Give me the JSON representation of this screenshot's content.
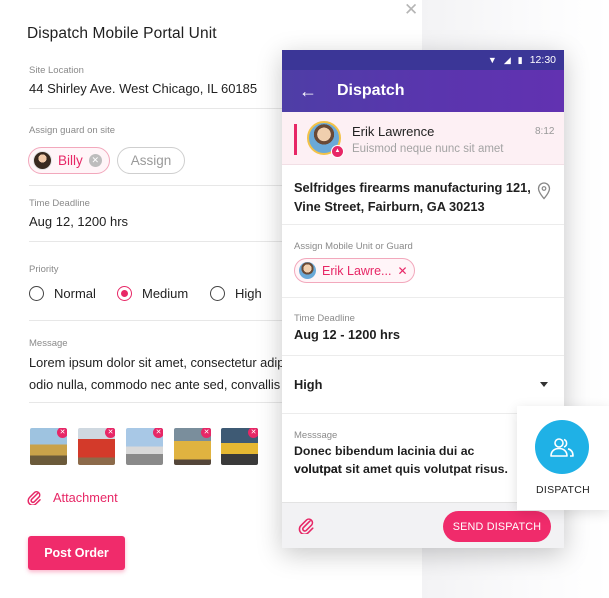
{
  "desktop": {
    "title": "Dispatch Mobile Portal Unit",
    "close_icon": "close-icon",
    "site_location_label": "Site Location",
    "site_location_value": "44 Shirley Ave. West Chicago, IL 60185",
    "assign_label": "Assign guard on site",
    "assigned_guard": "Billy",
    "assign_button": "Assign",
    "deadline_label": "Time Deadline",
    "deadline_value": "Aug 12, 1200 hrs",
    "priority_label": "Priority",
    "priority_options": [
      "Normal",
      "Medium",
      "High"
    ],
    "priority_selected": "Medium",
    "message_label": "Message",
    "message_lines": [
      "Lorem ipsum dolor sit amet, consectetur adipi",
      "odio nulla, commodo nec ante sed, convallis n"
    ],
    "attachment_label": "Attachment",
    "post_button": "Post Order"
  },
  "phone": {
    "status_time": "12:30",
    "title": "Dispatch",
    "notification": {
      "name": "Erik Lawrence",
      "text": "Euismod neque nunc sit amet",
      "time": "8:12"
    },
    "address_lines": [
      "Selfridges firearms manufacturing 121,",
      "Vine Street, Fairburn, GA 30213"
    ],
    "assign_label": "Assign Mobile Unit or Guard",
    "assigned_unit": "Erik Lawre...",
    "deadline_label": "Time Deadline",
    "deadline_value": "Aug 12 - 1200 hrs",
    "priority_value": "High",
    "message_label": "Messsage",
    "message_lines": [
      "Donec bibendum lacinia dui ac volutpat",
      "volutpat sit amet quis volutpat risus."
    ],
    "send_button": "SEND DISPATCH"
  },
  "fab": {
    "label": "DISPATCH",
    "icon": "users-icon"
  },
  "colors": {
    "accent": "#f02b6b",
    "brand": "#5039a8",
    "fab": "#1fb1e6"
  }
}
